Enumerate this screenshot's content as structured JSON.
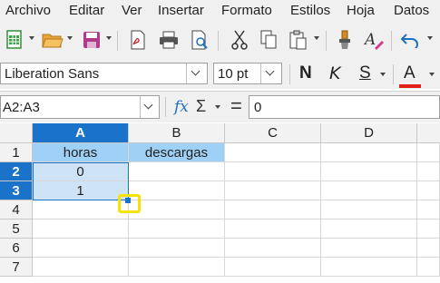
{
  "menu": [
    "Archivo",
    "Editar",
    "Ver",
    "Insertar",
    "Formato",
    "Estilos",
    "Hoja",
    "Datos"
  ],
  "toolbar": {
    "icons": [
      "new-spreadsheet-icon",
      "open-folder-icon",
      "save-icon",
      "export-pdf-icon",
      "print-icon",
      "print-preview-icon",
      "cut-icon",
      "copy-icon",
      "paste-icon",
      "clone-formatting-icon",
      "clear-formatting-icon",
      "undo-icon"
    ]
  },
  "format": {
    "font_name": "Liberation Sans",
    "font_size": "10 pt",
    "bold_label": "N",
    "italic_label": "K",
    "underline_label": "S",
    "font_color_label": "A",
    "font_color_bar": "#e0201b"
  },
  "formula_bar": {
    "name_box": "A2:A3",
    "fx_label": "fx",
    "sum_label": "Σ",
    "equals_label": "=",
    "content": "0"
  },
  "sheet": {
    "columns": [
      "A",
      "B",
      "C",
      "D"
    ],
    "rows": [
      "1",
      "2",
      "3",
      "4",
      "5",
      "6",
      "7"
    ],
    "selected_column": "A",
    "selected_rows": [
      "2",
      "3"
    ],
    "cells": {
      "A1": "horas",
      "B1": "descargas",
      "A2": "0",
      "A3": "1"
    }
  },
  "colors": {
    "accent": "#1a73c9",
    "header_fill": "#9fd0f5",
    "highlight_ring": "#f5e400"
  }
}
